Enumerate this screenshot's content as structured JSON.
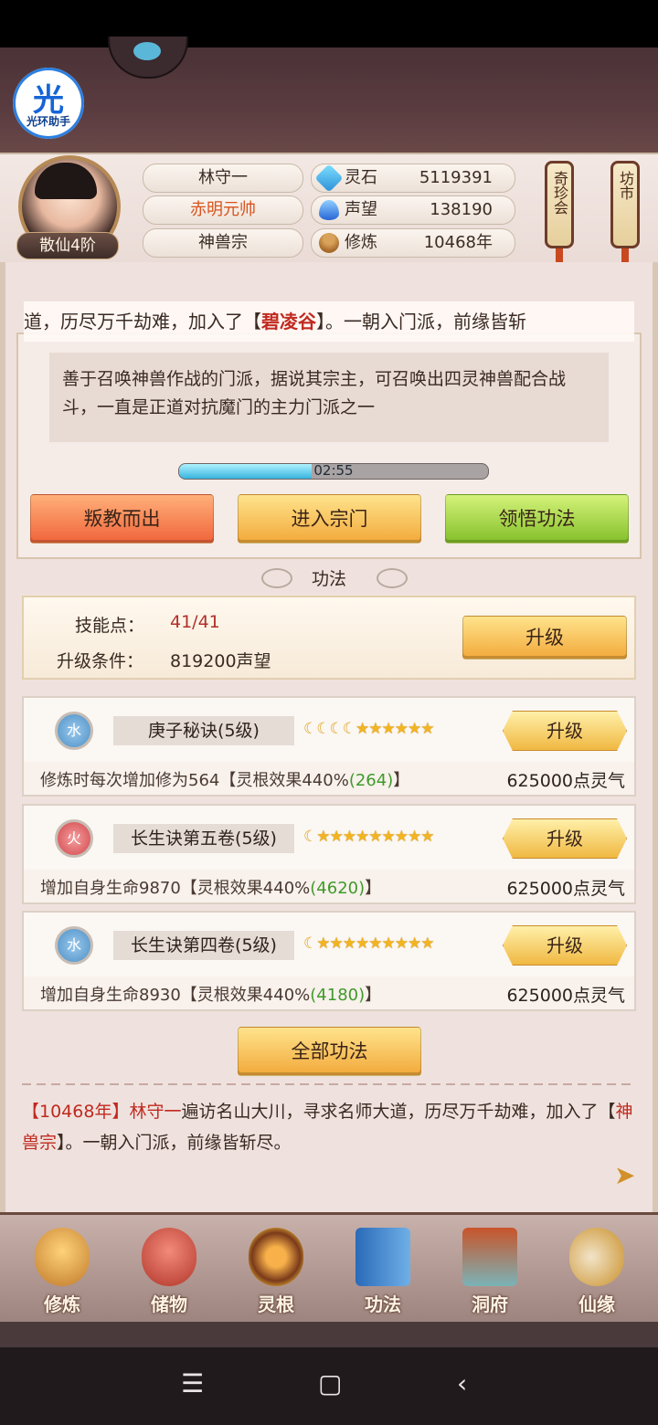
{
  "helper": {
    "glyph": "光",
    "label": "光环助手"
  },
  "player": {
    "name": "林守一",
    "title": "赤明元帅",
    "sect": "神兽宗",
    "rank": "散仙4阶",
    "stats": [
      {
        "icon": "spirit-stone-icon",
        "label": "灵石",
        "value": "5119391"
      },
      {
        "icon": "reputation-icon",
        "label": "声望",
        "value": "138190"
      },
      {
        "icon": "cultivation-icon",
        "label": "修炼",
        "value": "10468年"
      }
    ]
  },
  "side_buttons": {
    "treasure": "奇珍会",
    "market": "坊市"
  },
  "ticker": {
    "before": "道，历尽万千劫难，加入了【",
    "highlight": "碧凌谷",
    "after": "】。一朝入门派，前缘皆斩"
  },
  "sect_desc": "善于召唤神兽作战的门派，据说其宗主，可召唤出四灵神兽配合战斗，一直是正道对抗魔门的主力门派之一",
  "timer": {
    "text": "02:55",
    "progress": 0.43
  },
  "actions": {
    "betray": "叛教而出",
    "enter": "进入宗门",
    "learn": "领悟功法"
  },
  "section_title": "功法",
  "skill_points": {
    "label": "技能点：",
    "value": "41/41",
    "cond_label": "升级条件：",
    "cond_value": "819200声望",
    "upgrade": "升级"
  },
  "skills": [
    {
      "element": "水",
      "name": "庚子秘诀(5级)",
      "moons": 4,
      "stars": 6,
      "upgrade": "升级",
      "desc_pre": "修炼时每次增加修为564【灵根效果440%",
      "desc_green": "(264)",
      "desc_post": "】",
      "cost": "625000点灵气"
    },
    {
      "element": "火",
      "name": "长生诀第五卷(5级)",
      "moons": 1,
      "stars": 9,
      "upgrade": "升级",
      "desc_pre": "增加自身生命9870【灵根效果440%",
      "desc_green": "(4620)",
      "desc_post": "】",
      "cost": "625000点灵气"
    },
    {
      "element": "水",
      "name": "长生诀第四卷(5级)",
      "moons": 1,
      "stars": 9,
      "upgrade": "升级",
      "desc_pre": "增加自身生命8930【灵根效果440%",
      "desc_green": "(4180)",
      "desc_post": "】",
      "cost": "625000点灵气"
    }
  ],
  "all_skills": "全部功法",
  "log": {
    "p1": "【10468年】",
    "p2": "林守一",
    "p3": "遍访名山大川，寻求名师大道，历尽万千劫难，加入了【",
    "p4": "神兽宗",
    "p5": "】。一朝入门派，前缘皆斩尽。"
  },
  "nav": [
    "修炼",
    "储物",
    "灵根",
    "功法",
    "洞府",
    "仙缘"
  ],
  "colors": {
    "accent_red": "#c0291f",
    "green": "#3f9a2a",
    "gold": "#f2a93a"
  }
}
